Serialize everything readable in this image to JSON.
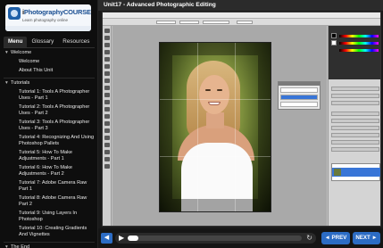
{
  "logo": {
    "brand_prefix": "i",
    "brand_main": "Photography",
    "brand_suffix": "COURSE.com",
    "tagline": "Learn photography online"
  },
  "sidebar": {
    "tabs": [
      "Menu",
      "Glossary",
      "Resources"
    ],
    "items": [
      {
        "label": "Welcome",
        "kind": "section"
      },
      {
        "label": "Welcome",
        "kind": "item"
      },
      {
        "label": "About This Unit",
        "kind": "item"
      },
      {
        "label": "Tutorials",
        "kind": "section"
      },
      {
        "label": "Tutorial 1: Tools A Photographer Uses - Part 1",
        "kind": "item"
      },
      {
        "label": "Tutorial 2: Tools A Photographer Uses - Part 2",
        "kind": "item"
      },
      {
        "label": "Tutorial 3: Tools A Photographer Uses - Part 3",
        "kind": "item"
      },
      {
        "label": "Tutorial 4: Recognizing And Using Photoshop Pallets",
        "kind": "item"
      },
      {
        "label": "Tutorial 5: How To Make Adjustments - Part 1",
        "kind": "item"
      },
      {
        "label": "Tutorial 6: How To Make Adjustments - Part 2",
        "kind": "item"
      },
      {
        "label": "Tutorial 7: Adobe Camera Raw Part 1",
        "kind": "item"
      },
      {
        "label": "Tutorial 8: Adobe Camera Raw Part 2",
        "kind": "item"
      },
      {
        "label": "Tutorial 9: Using Layers In Photoshop",
        "kind": "item"
      },
      {
        "label": "Tutorial 10: Creating Gradients And Vignettes",
        "kind": "item"
      },
      {
        "label": "The End",
        "kind": "section"
      }
    ]
  },
  "header": {
    "title": "Unit17 - Advanced Photographic Editing"
  },
  "controls": {
    "sound_icon": "speaker-icon",
    "play_icon": "play-icon",
    "replay_icon": "replay-icon",
    "progress": 0.06,
    "prev_label": "◄ PREV",
    "next_label": "NEXT ►"
  },
  "colors": {
    "accent": "#2c6cc4",
    "background": "#111111"
  }
}
